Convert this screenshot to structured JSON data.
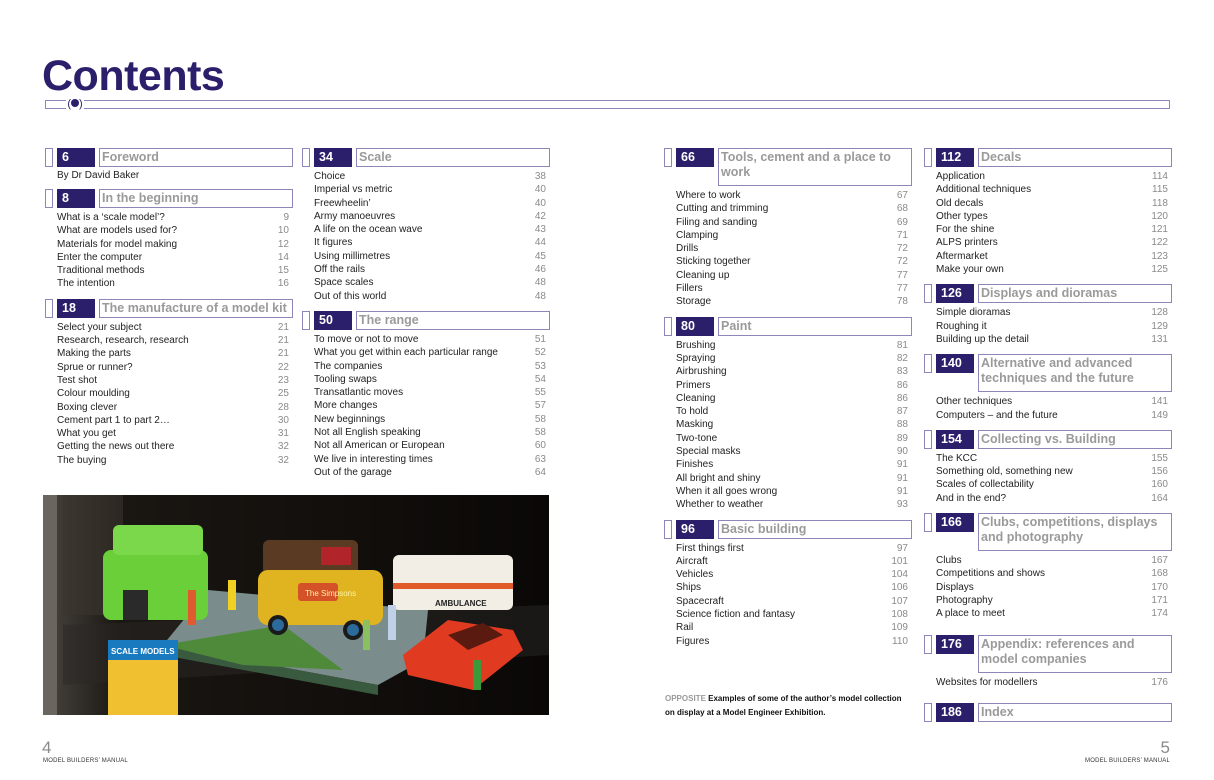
{
  "title": "Contents",
  "columns": [
    [
      {
        "num": "6",
        "title": "Foreword",
        "author": "By Dr David Baker",
        "items": []
      },
      {
        "num": "8",
        "title": "In the beginning",
        "items": [
          {
            "t": "What is a ‘scale model’?",
            "p": "9"
          },
          {
            "t": "What are models used for?",
            "p": "10"
          },
          {
            "t": "Materials for model making",
            "p": "12"
          },
          {
            "t": "Enter the computer",
            "p": "14"
          },
          {
            "t": "Traditional methods",
            "p": "15"
          },
          {
            "t": "The intention",
            "p": "16"
          }
        ]
      },
      {
        "num": "18",
        "title": "The manufacture of a model kit",
        "items": [
          {
            "t": "Select your subject",
            "p": "21"
          },
          {
            "t": "Research, research, research",
            "p": "21"
          },
          {
            "t": "Making the parts",
            "p": "21"
          },
          {
            "t": "Sprue or runner?",
            "p": "22"
          },
          {
            "t": "Test shot",
            "p": "23"
          },
          {
            "t": "Colour moulding",
            "p": "25"
          },
          {
            "t": "Boxing clever",
            "p": "28"
          },
          {
            "t": "Cement part 1 to part 2…",
            "p": "30"
          },
          {
            "t": "What you get",
            "p": "31"
          },
          {
            "t": "Getting the news out there",
            "p": "32"
          },
          {
            "t": "The buying",
            "p": "32"
          }
        ]
      }
    ],
    [
      {
        "num": "34",
        "title": "Scale",
        "items": [
          {
            "t": "Choice",
            "p": "38"
          },
          {
            "t": "Imperial vs metric",
            "p": "40"
          },
          {
            "t": "Freewheelin’",
            "p": "40"
          },
          {
            "t": "Army manoeuvres",
            "p": "42"
          },
          {
            "t": "A life on the ocean wave",
            "p": "43"
          },
          {
            "t": "It figures",
            "p": "44"
          },
          {
            "t": "Using millimetres",
            "p": "45"
          },
          {
            "t": "Off the rails",
            "p": "46"
          },
          {
            "t": "Space scales",
            "p": "48"
          },
          {
            "t": "Out of this world",
            "p": "48"
          }
        ]
      },
      {
        "num": "50",
        "title": "The range",
        "items": [
          {
            "t": "To move or not to move",
            "p": "51"
          },
          {
            "t": "What you get within each particular range",
            "p": "52"
          },
          {
            "t": "The companies",
            "p": "53"
          },
          {
            "t": "Tooling swaps",
            "p": "54"
          },
          {
            "t": "Transatlantic moves",
            "p": "55"
          },
          {
            "t": "More changes",
            "p": "57"
          },
          {
            "t": "New beginnings",
            "p": "58"
          },
          {
            "t": "Not all English speaking",
            "p": "58"
          },
          {
            "t": "Not all American or European",
            "p": "60"
          },
          {
            "t": "We live in interesting times",
            "p": "63"
          },
          {
            "t": "Out of the garage",
            "p": "64"
          }
        ]
      }
    ],
    [
      {
        "num": "66",
        "title": "Tools, cement and a place to work",
        "tall": true,
        "items": [
          {
            "t": "Where to work",
            "p": "67"
          },
          {
            "t": "Cutting and trimming",
            "p": "68"
          },
          {
            "t": "Filing and sanding",
            "p": "69"
          },
          {
            "t": "Clamping",
            "p": "71"
          },
          {
            "t": "Drills",
            "p": "72"
          },
          {
            "t": "Sticking together",
            "p": "72"
          },
          {
            "t": "Cleaning up",
            "p": "77"
          },
          {
            "t": "Fillers",
            "p": "77"
          },
          {
            "t": "Storage",
            "p": "78"
          }
        ]
      },
      {
        "num": "80",
        "title": "Paint",
        "items": [
          {
            "t": "Brushing",
            "p": "81"
          },
          {
            "t": "Spraying",
            "p": "82"
          },
          {
            "t": "Airbrushing",
            "p": "83"
          },
          {
            "t": "Primers",
            "p": "86"
          },
          {
            "t": "Cleaning",
            "p": "86"
          },
          {
            "t": "To hold",
            "p": "87"
          },
          {
            "t": "Masking",
            "p": "88"
          },
          {
            "t": "Two-tone",
            "p": "89"
          },
          {
            "t": "Special masks",
            "p": "90"
          },
          {
            "t": "Finishes",
            "p": "91"
          },
          {
            "t": "All bright and shiny",
            "p": "91"
          },
          {
            "t": "When it all goes wrong",
            "p": "91"
          },
          {
            "t": "Whether to weather",
            "p": "93"
          }
        ]
      },
      {
        "num": "96",
        "title": "Basic building",
        "items": [
          {
            "t": "First things first",
            "p": "97"
          },
          {
            "t": "Aircraft",
            "p": "101"
          },
          {
            "t": "Vehicles",
            "p": "104"
          },
          {
            "t": "Ships",
            "p": "106"
          },
          {
            "t": "Spacecraft",
            "p": "107"
          },
          {
            "t": "Science fiction and fantasy",
            "p": "108"
          },
          {
            "t": "Rail",
            "p": "109"
          },
          {
            "t": "Figures",
            "p": "110"
          }
        ]
      }
    ],
    [
      {
        "num": "112",
        "title": "Decals",
        "items": [
          {
            "t": "Application",
            "p": "114"
          },
          {
            "t": "Additional techniques",
            "p": "115"
          },
          {
            "t": "Old decals",
            "p": "118"
          },
          {
            "t": "Other types",
            "p": "120"
          },
          {
            "t": "For the shine",
            "p": "121"
          },
          {
            "t": "ALPS printers",
            "p": "122"
          },
          {
            "t": "Aftermarket",
            "p": "123"
          },
          {
            "t": "Make your own",
            "p": "125"
          }
        ]
      },
      {
        "num": "126",
        "title": "Displays and dioramas",
        "items": [
          {
            "t": "Simple dioramas",
            "p": "128"
          },
          {
            "t": "Roughing it",
            "p": "129"
          },
          {
            "t": "Building up the detail",
            "p": "131"
          }
        ]
      },
      {
        "num": "140",
        "title": "Alternative and advanced techniques and the future",
        "tall": true,
        "items": [
          {
            "t": "Other techniques",
            "p": "141"
          },
          {
            "t": "Computers – and the future",
            "p": "149"
          }
        ]
      },
      {
        "num": "154",
        "title": "Collecting vs. Building",
        "items": [
          {
            "t": "The KCC",
            "p": "155"
          },
          {
            "t": "Something old, something new",
            "p": "156"
          },
          {
            "t": "Scales of collectability",
            "p": "160"
          },
          {
            "t": "And in the end?",
            "p": "164"
          }
        ]
      },
      {
        "num": "166",
        "title": "Clubs, competitions, displays and photography",
        "tall": true,
        "items": [
          {
            "t": "Clubs",
            "p": "167"
          },
          {
            "t": "Competitions and shows",
            "p": "168"
          },
          {
            "t": "Displays",
            "p": "170"
          },
          {
            "t": "Photography",
            "p": "171"
          },
          {
            "t": "A place to meet",
            "p": "174"
          }
        ]
      },
      {
        "num": "176",
        "title": "Appendix: references and model companies",
        "tall": true,
        "items": [
          {
            "t": "Websites for modellers",
            "p": "176"
          }
        ]
      },
      {
        "num": "186",
        "title": "Index",
        "items": []
      }
    ]
  ],
  "photo": {
    "alt": "Model vehicles and Simpsons figure diorama on display in a glass cabinet",
    "van_logo": "The Simpsons",
    "ambulance_label": "AMBULANCE",
    "magazine_label": "SCALE MODELS"
  },
  "caption": {
    "lead": "OPPOSITE",
    "text": " Examples of some of the author’s model collection on display at a Model Engineer Exhibition."
  },
  "footer": {
    "left_page": "4",
    "right_page": "5",
    "running_title": "MODEL BUILDERS’ MANUAL"
  },
  "colors": {
    "accent": "#2b1f6b",
    "frame": "#8d86b8",
    "title_grey": "#9a9a9a"
  }
}
